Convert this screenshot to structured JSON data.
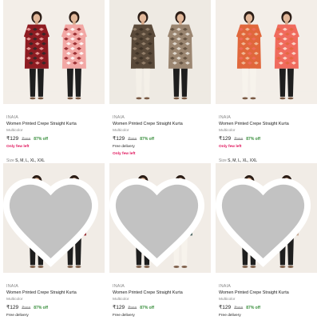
{
  "accent": {
    "green": "#388e3c",
    "pink": "#e1155c",
    "grey": "#878787"
  },
  "products": [
    {
      "brand": "INAIA",
      "title": "Women Printed Crepe Straight Kurta",
      "color": "Multicolor",
      "price": "₹129",
      "mrp": "₹999",
      "off": "87% off",
      "delivery": "",
      "stock": "Only few left",
      "size_label": "Size",
      "sizes": "S, M, L, XL, XXL",
      "wishlist_icon": "heart-icon",
      "palette": {
        "bg": "#f3eee8",
        "a": "#8e1c22",
        "b": "#2a2a2a",
        "c": "#f2a7a4",
        "d": "#ffffff",
        "pant_a": "#1e1e1e",
        "pant_b": "#1e1e1e"
      }
    },
    {
      "brand": "INAIA",
      "title": "Women Printed Crepe Straight Kurta",
      "color": "Multicolor",
      "price": "₹129",
      "mrp": "₹999",
      "off": "87% off",
      "delivery": "Free delivery",
      "stock": "Only few left",
      "size_label": "",
      "sizes": "",
      "wishlist_icon": "heart-icon",
      "palette": {
        "bg": "#eeeae3",
        "a": "#5a4a3a",
        "b": "#3b2f25",
        "c": "#9b8671",
        "d": "#e9e3da",
        "pant_a": "#f4f0e8",
        "pant_b": "#1e1e1e"
      }
    },
    {
      "brand": "INAIA",
      "title": "Women Printed Crepe Straight Kurta",
      "color": "Multicolor",
      "price": "₹129",
      "mrp": "₹999",
      "off": "87% off",
      "delivery": "",
      "stock": "Only few left",
      "size_label": "Size",
      "sizes": "S, M, L, XL, XXL",
      "wishlist_icon": "heart-icon",
      "palette": {
        "bg": "#f3eee8",
        "a": "#e0673b",
        "b": "#f2c6a2",
        "c": "#f06b5e",
        "d": "#fbe3d6",
        "pant_a": "#f7f3ec",
        "pant_b": "#1e1e1e"
      }
    },
    {
      "brand": "INAIA",
      "title": "Women Printed Crepe Straight Kurta",
      "color": "Multicolor",
      "price": "₹129",
      "mrp": "₹999",
      "off": "87% off",
      "delivery": "Free delivery",
      "stock": "",
      "size_label": "",
      "sizes": "",
      "wishlist_icon": "heart-icon",
      "palette": {
        "bg": "#f1ece6",
        "a": "#b7836f",
        "b": "#6e3b3b",
        "c": "#8e1c22",
        "d": "#eadcd0",
        "pant_a": "#1e1e1e",
        "pant_b": "#1e1e1e"
      }
    },
    {
      "brand": "INAIA",
      "title": "Women Printed Crepe Straight Kurta",
      "color": "Multicolor",
      "price": "₹129",
      "mrp": "₹999",
      "off": "87% off",
      "delivery": "Free delivery",
      "stock": "",
      "size_label": "",
      "sizes": "",
      "wishlist_icon": "heart-icon",
      "palette": {
        "bg": "#f1ece6",
        "a": "#e58f7f",
        "b": "#f6d9cf",
        "c": "#3f5b58",
        "d": "#d9ddd8",
        "pant_a": "#1e1e1e",
        "pant_b": "#f7f3ec"
      }
    },
    {
      "brand": "INAIA",
      "title": "Women Printed Crepe Straight Kurta",
      "color": "Multicolor",
      "price": "₹129",
      "mrp": "₹999",
      "off": "87% off",
      "delivery": "Free delivery",
      "stock": "",
      "size_label": "",
      "sizes": "",
      "wishlist_icon": "heart-icon",
      "palette": {
        "bg": "#f1ece6",
        "a": "#ee8f7a",
        "b": "#f8dbcf",
        "c": "#c4a48e",
        "d": "#e8d9cc",
        "pant_a": "#1e1e1e",
        "pant_b": "#1e1e1e"
      }
    }
  ]
}
